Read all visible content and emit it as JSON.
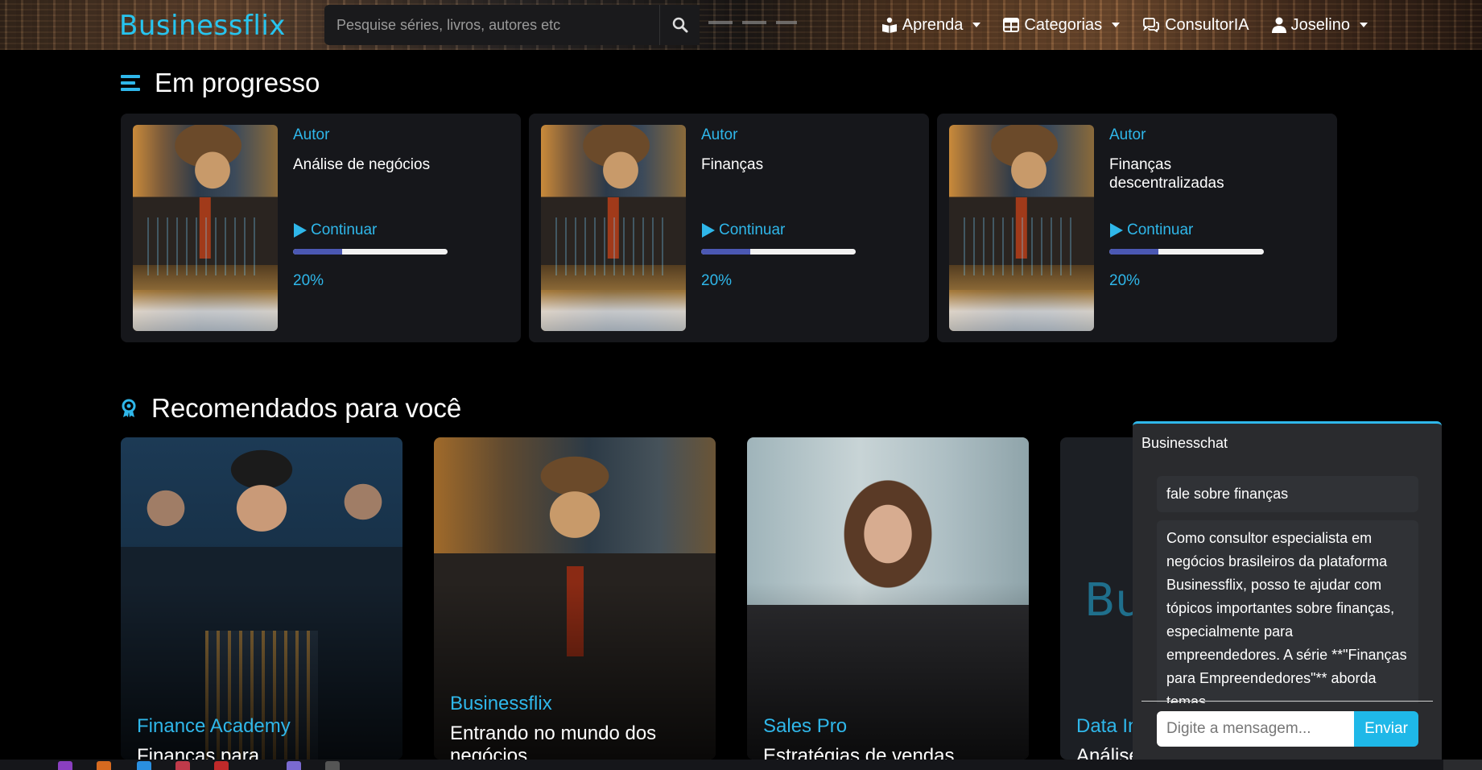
{
  "nav": {
    "logo": "Businessflix",
    "search_placeholder": "Pesquise séries, livros, autores etc",
    "items": [
      {
        "label": "Aprenda",
        "icon": "book-reader-icon",
        "dropdown": true
      },
      {
        "label": "Categorias",
        "icon": "grid-table-icon",
        "dropdown": true
      },
      {
        "label": "ConsultorIA",
        "icon": "chat-bubbles-icon",
        "dropdown": false
      },
      {
        "label": "Joselino",
        "icon": "user-icon",
        "dropdown": true
      }
    ]
  },
  "in_progress": {
    "title": "Em progresso",
    "cards": [
      {
        "author": "Autor",
        "title": "Análise de negócios",
        "continue_label": "Continuar",
        "progress": 0.32,
        "percent_label": "20%"
      },
      {
        "author": "Autor",
        "title": "Finanças",
        "continue_label": "Continuar",
        "progress": 0.32,
        "percent_label": "20%"
      },
      {
        "author": "Autor",
        "title": "Finanças descentralizadas",
        "continue_label": "Continuar",
        "progress": 0.32,
        "percent_label": "20%"
      }
    ]
  },
  "recommended": {
    "title": "Recomendados para você",
    "cards": [
      {
        "source": "Finance Academy",
        "title": "Finanças para empreendedores",
        "art": "finance"
      },
      {
        "source": "Businessflix",
        "title": "Entrando no mundo dos negócios",
        "art": "business"
      },
      {
        "source": "Sales Pro",
        "title": "Estratégias de vendas",
        "art": "sales"
      },
      {
        "source": "Data In",
        "title": "Análise",
        "art": "data",
        "bigtext": "Bu"
      }
    ]
  },
  "chat": {
    "title": "Businesschat",
    "messages": [
      {
        "role": "user",
        "text": "fale sobre finanças"
      },
      {
        "role": "assistant",
        "text": "Como consultor especialista em negócios brasileiros da plataforma Businessflix, posso te ajudar com tópicos importantes sobre finanças, especialmente para empreendedores. A série **\"Finanças para Empreendedores\"** aborda temas"
      }
    ],
    "input_placeholder": "Digite a mensagem...",
    "send_label": "Enviar"
  },
  "colors": {
    "accent": "#2fb7ea",
    "card_bg": "#16171b",
    "progress_fill": "#4b58b3",
    "chat_bg": "#2a2b2e",
    "send_button": "#1fb8e8"
  }
}
